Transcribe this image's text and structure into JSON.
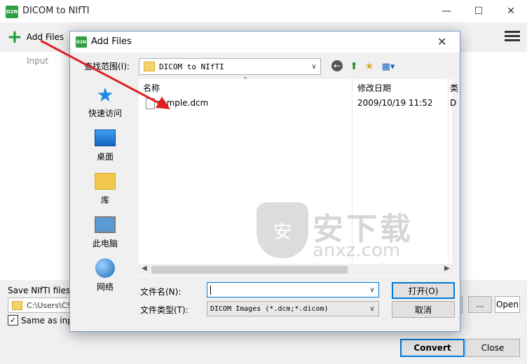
{
  "app": {
    "title": "DICOM to NIfTI",
    "logo_text": "D2N",
    "accent": "#2e9e3e"
  },
  "window_controls": [
    "minimize-icon",
    "maximize-icon",
    "close-icon"
  ],
  "toolbar": {
    "add_files_label": "Add Files",
    "add_icon": "plus-icon",
    "menu_icon": "hamburger-icon"
  },
  "list": {
    "column_input": "Input"
  },
  "output": {
    "save_label": "Save NIfTI files to",
    "path": "C:\\Users\\CS\\",
    "same_as_input_label": "Same as input",
    "same_as_input_checked": true,
    "browse_label": "...",
    "open_label": "Open"
  },
  "buttons": {
    "convert": "Convert",
    "close": "Close"
  },
  "dialog": {
    "title": "Add Files",
    "logo_text": "D2N",
    "look_in_label": "查找范围(I):",
    "look_in_value": "DICOM to NIfTI",
    "places": [
      {
        "label": "快速访问",
        "icon": "star-icon"
      },
      {
        "label": "桌面",
        "icon": "desktop-icon"
      },
      {
        "label": "库",
        "icon": "library-icon"
      },
      {
        "label": "此电脑",
        "icon": "computer-icon"
      },
      {
        "label": "网络",
        "icon": "network-icon"
      }
    ],
    "columns": {
      "name": "名称",
      "date": "修改日期",
      "third": "类"
    },
    "files": [
      {
        "name": "sample.dcm",
        "date": "2009/10/19 11:52",
        "third": "D"
      }
    ],
    "file_name_label": "文件名(N):",
    "file_name_value": "",
    "file_type_label": "文件类型(T):",
    "file_type_value": "DICOM Images (*.dcm;*.dicom)",
    "open_button": "打开(O)",
    "cancel_button": "取消"
  },
  "watermark": {
    "title": "安下载",
    "subtitle": "anxz.com",
    "shield_text": "安"
  },
  "annotation": {
    "arrow_color": "#e02020"
  }
}
